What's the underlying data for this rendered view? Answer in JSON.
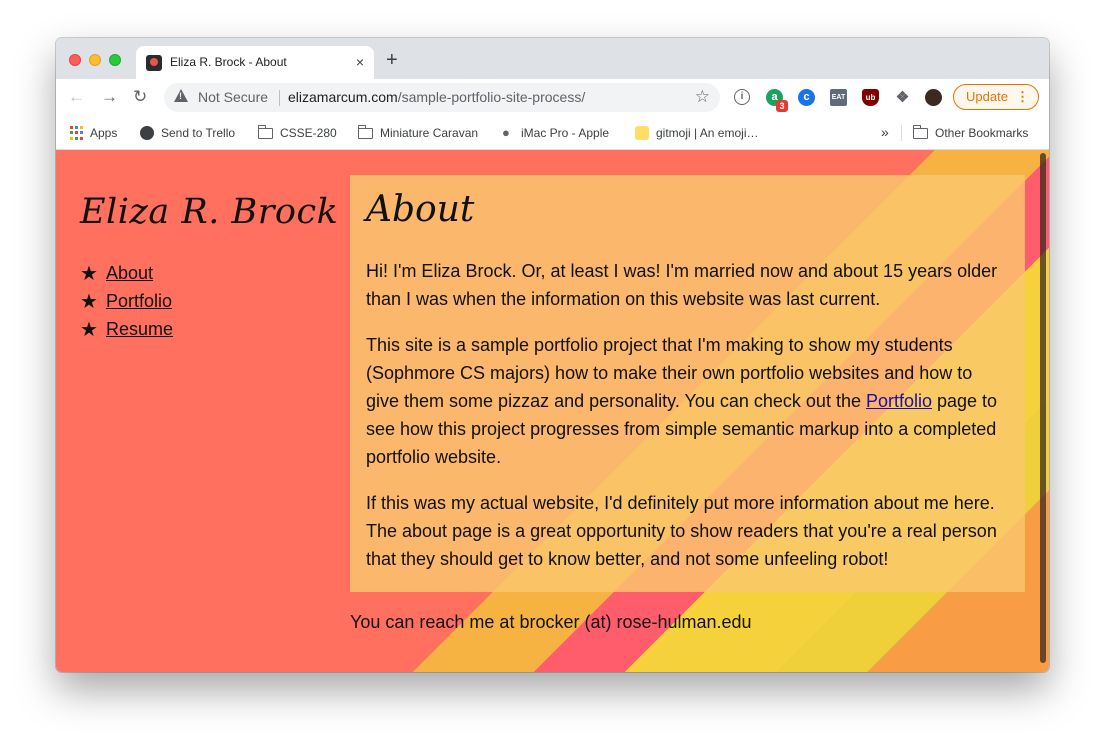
{
  "tab": {
    "title": "Eliza R. Brock - About",
    "close": "×"
  },
  "newtab": "+",
  "toolbar": {
    "not_secure": "Not Secure",
    "url_host": "elizamarcum.com",
    "url_path": "/sample-portfolio-site-process/",
    "update_label": "Update",
    "ext_badge": "3"
  },
  "bookmarks": {
    "apps": "Apps",
    "trello": "Send to Trello",
    "csse": "CSSE-280",
    "caravan": "Miniature Caravan",
    "imac": "iMac Pro - Apple",
    "gitmoji": "gitmoji | An emoji…",
    "overflow": "»",
    "other": "Other Bookmarks"
  },
  "site": {
    "title": "Eliza R. Brock",
    "nav": [
      {
        "label": "About"
      },
      {
        "label": "Portfolio"
      },
      {
        "label": "Resume"
      }
    ],
    "heading": "About",
    "p1": "Hi! I'm Eliza Brock. Or, at least I was! I'm married now and about 15 years older than I was when the information on this website was last current.",
    "p2_before": "This site is a sample portfolio project that I'm making to show my students (Sophmore CS majors) how to make their own portfolio websites and how to give them some pizzaz and personality. You can check out the ",
    "p2_link": "Portfolio",
    "p2_after": " page to see how this project progresses from simple semantic markup into a completed portfolio website.",
    "p3": "If this was my actual website, I'd definitely put more information about me here. The about page is a great opportunity to show readers that you're a real person that they should get to know better, and not some unfeeling robot!",
    "contact": "You can reach me at brocker (at) rose-hulman.edu"
  }
}
